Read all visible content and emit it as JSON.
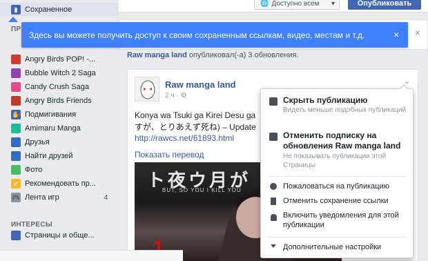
{
  "sidebar": {
    "saved_label": "Сохраненное",
    "section_partial": "ПРИ",
    "items": [
      {
        "label": "Angry Birds POP! -...",
        "icon": "angry-birds-pop-icon",
        "color": "#d43a2f"
      },
      {
        "label": "Bubble Witch 2 Saga",
        "icon": "bubble-witch-icon",
        "color": "#8e44ad"
      },
      {
        "label": "Candy Crush Saga",
        "icon": "candy-crush-icon",
        "color": "#e64a8a"
      },
      {
        "label": "Angry Birds Friends",
        "icon": "angry-birds-friends-icon",
        "color": "#c0392b"
      },
      {
        "label": "Подмигивания",
        "icon": "pokes-icon",
        "color": "#4267b2"
      },
      {
        "label": "Amimaru Manga",
        "icon": "amimaru-manga-icon",
        "color": "#1abc9c"
      },
      {
        "label": "Друзья",
        "icon": "friends-icon",
        "color": "#4267b2"
      },
      {
        "label": "Найти друзей",
        "icon": "find-friends-icon",
        "color": "#4267b2"
      },
      {
        "label": "Фото",
        "icon": "photos-icon",
        "color": "#45bd62"
      },
      {
        "label": "Рекомендовать пр...",
        "icon": "recommend-pages-icon",
        "color": "#f7b928"
      },
      {
        "label": "Лента игр",
        "icon": "games-feed-icon",
        "color": "#90949c",
        "count": "4"
      }
    ],
    "interests_header": "ИНТЕРЕСЫ",
    "pages_lists_label": "Страницы и обще..."
  },
  "topbar": {
    "privacy_label": "Доступно всем",
    "publish_label": "Опубликовать"
  },
  "tooltip": {
    "text": "Здесь вы можете получить доступ к своим сохраненным ссылкам, видео, местам и т.д.",
    "close": "×"
  },
  "feed": {
    "page": "Raw manga land",
    "action": "опубликовал(-а) 3 обновления."
  },
  "post": {
    "page_name": "Raw manga land",
    "time": "2 ч · ",
    "text_line1": "Konya wa Tsuki ga Kirei Desu ga",
    "text_line2": "すが、とりあえず死ね) – Update",
    "link": "http://rawcs.net/61893.html",
    "translate": "Показать перевод",
    "chevron": "⌄",
    "image_title": "ト夜ウ月が",
    "image_sub": "BUT, SO YOU I KILL YOU",
    "image_one": "1"
  },
  "menu": {
    "hide_title": "Скрыть публикацию",
    "hide_sub": "Видеть меньше подобных публикаций",
    "unfollow_title": "Отменить подписку на обновления Raw manga land",
    "unfollow_sub": "Не показывать публикации этой Страницы",
    "report": "Пожаловаться на публикацию",
    "unsave": "Отменить сохранение ссылки",
    "notifications": "Включить уведомления для этой публикации",
    "more": "Дополнительные настройки"
  },
  "colors": {
    "tooltip_bg": "#4080ff",
    "brand": "#4267b2",
    "link": "#365899"
  }
}
